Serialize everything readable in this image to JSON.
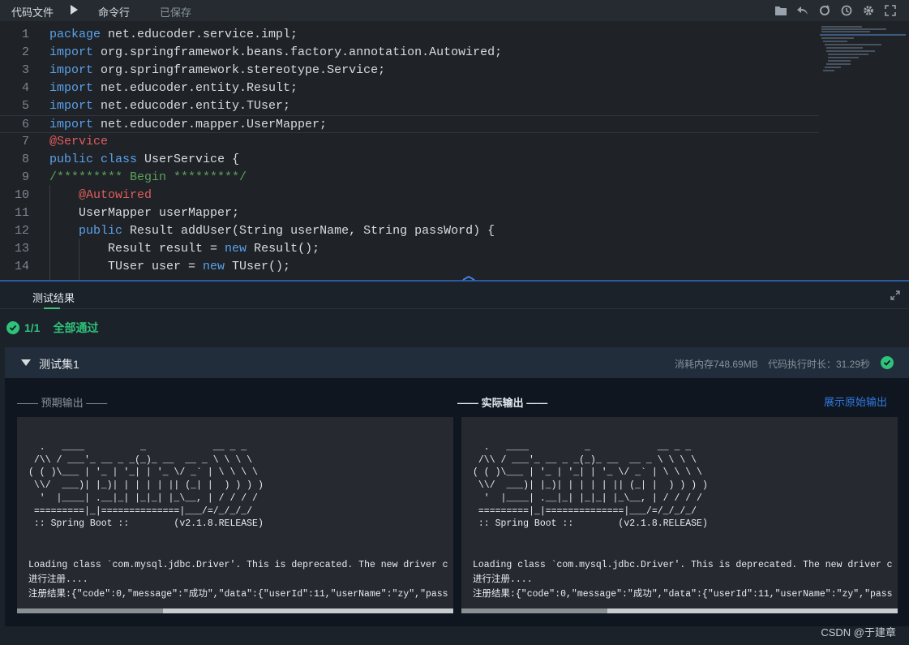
{
  "toolbar": {
    "file_tab": "代码文件",
    "command_tab": "命令行",
    "saved_status": "已保存",
    "icons": [
      "folder-icon",
      "undo-icon",
      "refresh-icon",
      "history-icon",
      "gear-icon",
      "fullscreen-icon"
    ]
  },
  "editor": {
    "lines": [
      {
        "n": "1",
        "parts": [
          {
            "t": "package",
            "c": "kw"
          },
          {
            "t": " net.educoder.service.impl;",
            "c": ""
          }
        ]
      },
      {
        "n": "2",
        "parts": [
          {
            "t": "import",
            "c": "kw"
          },
          {
            "t": " org.springframework.beans.factory.annotation.Autowired;",
            "c": ""
          }
        ]
      },
      {
        "n": "3",
        "parts": [
          {
            "t": "import",
            "c": "kw"
          },
          {
            "t": " org.springframework.stereotype.Service;",
            "c": ""
          }
        ]
      },
      {
        "n": "4",
        "parts": [
          {
            "t": "import",
            "c": "kw"
          },
          {
            "t": " net.educoder.entity.Result;",
            "c": ""
          }
        ]
      },
      {
        "n": "5",
        "parts": [
          {
            "t": "import",
            "c": "kw"
          },
          {
            "t": " net.educoder.entity.TUser;",
            "c": ""
          }
        ]
      },
      {
        "n": "6",
        "parts": [
          {
            "t": "import",
            "c": "kw"
          },
          {
            "t": " net.educoder.mapper.UserMapper;",
            "c": ""
          }
        ]
      },
      {
        "n": "7",
        "parts": [
          {
            "t": "@Service",
            "c": "ann"
          }
        ]
      },
      {
        "n": "8",
        "parts": [
          {
            "t": "public",
            "c": "kw"
          },
          {
            "t": " ",
            "c": ""
          },
          {
            "t": "class",
            "c": "kw"
          },
          {
            "t": " UserService {",
            "c": ""
          }
        ]
      },
      {
        "n": "9",
        "parts": [
          {
            "t": "/********* Begin *********/",
            "c": "cm"
          }
        ]
      },
      {
        "n": "10",
        "parts": [
          {
            "t": "    ",
            "c": ""
          },
          {
            "t": "@Autowired",
            "c": "ann"
          }
        ]
      },
      {
        "n": "11",
        "parts": [
          {
            "t": "    UserMapper userMapper;",
            "c": ""
          }
        ]
      },
      {
        "n": "12",
        "parts": [
          {
            "t": "    ",
            "c": ""
          },
          {
            "t": "public",
            "c": "kw"
          },
          {
            "t": " Result addUser(String userName, String passWord) {",
            "c": ""
          }
        ]
      },
      {
        "n": "13",
        "parts": [
          {
            "t": "        Result result = ",
            "c": ""
          },
          {
            "t": "new",
            "c": "kw"
          },
          {
            "t": " Result();",
            "c": ""
          }
        ]
      },
      {
        "n": "14",
        "parts": [
          {
            "t": "        TUser user = ",
            "c": ""
          },
          {
            "t": "new",
            "c": "kw"
          },
          {
            "t": " TUser();",
            "c": ""
          }
        ]
      }
    ]
  },
  "results": {
    "tab_label": "测试结果",
    "pass_count": "1/1",
    "pass_status": "全部通过",
    "testset": {
      "title": "测试集1",
      "memory": "消耗内存748.69MB",
      "duration": "代码执行时长：31.29秒"
    },
    "expected_label": "—— 预期输出 ——",
    "actual_label": "—— 实际输出 ——",
    "raw_link": "展示原始输出",
    "ascii_lines": [
      "  .   ____          _            __ _ _",
      " /\\\\ / ___'_ __ _ _(_)_ __  __ _ \\ \\ \\ \\",
      "( ( )\\___ | '_ | '_| | '_ \\/ _` | \\ \\ \\ \\",
      " \\\\/  ___)| |_)| | | | | || (_| |  ) ) ) )",
      "  '  |____| .__|_| |_|_| |_\\__, | / / / /",
      " =========|_|==============|___/=/_/_/_/",
      " :: Spring Boot ::        (v2.1.8.RELEASE)"
    ],
    "log_lines": [
      "Loading class `com.mysql.jdbc.Driver'. This is deprecated. The new driver c",
      "进行注册....",
      "注册结果:{\"code\":0,\"message\":\"成功\",\"data\":{\"userId\":11,\"userName\":\"zy\",\"pass"
    ]
  },
  "watermark": "CSDN @于建章"
}
